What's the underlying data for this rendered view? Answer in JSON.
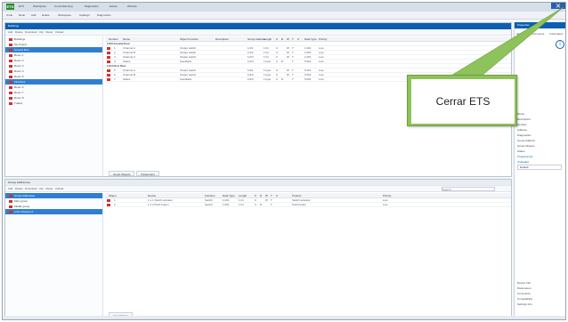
{
  "app": {
    "logo_text": "ETS",
    "menu": [
      "ETS",
      "Workspace",
      "Commissioning",
      "Diagnostics",
      "Extras",
      "Window"
    ],
    "close_icon": "close-icon"
  },
  "toolbar": {
    "items": [
      "Undo",
      "Redo",
      "Add",
      "Delete",
      "Workspace",
      "Catalogs",
      "Diagnostics"
    ]
  },
  "top_panel": {
    "title": "Buildings",
    "toolbar_items": [
      "Add",
      "Delete",
      "Download",
      "Info",
      "Reset",
      "Unload"
    ],
    "search_placeholder": "Search",
    "tree": [
      {
        "label": "Buildings",
        "selected": false
      },
      {
        "label": "My Project",
        "selected": false
      },
      {
        "label": "Ground floor",
        "selected": true
      },
      {
        "label": "Room 1",
        "selected": false
      },
      {
        "label": "Room 2",
        "selected": false
      },
      {
        "label": "Room 3",
        "selected": false
      },
      {
        "label": "Room 4",
        "selected": false
      },
      {
        "label": "Room 5",
        "selected": false
      },
      {
        "label": "First floor",
        "selected": true
      },
      {
        "label": "Room 6",
        "selected": false
      },
      {
        "label": "Room 7",
        "selected": false
      },
      {
        "label": "Room 8",
        "selected": false
      },
      {
        "label": "Trades",
        "selected": false
      }
    ],
    "columns": [
      "Number",
      "Name",
      "Object Function",
      "Description",
      "Group Address",
      "Length",
      "C",
      "R",
      "W",
      "T",
      "U",
      "Data Type",
      "Priority"
    ],
    "group_rows": [
      {
        "header": "1/1/3 Ground floor"
      },
      {
        "cells": [
          "1",
          "Channel A",
          "Output switch",
          "",
          "1/1/1",
          "1 bit",
          "C",
          "",
          "W",
          "T",
          "",
          "1.001",
          "Low"
        ]
      },
      {
        "cells": [
          "2",
          "Channel B",
          "Output switch",
          "",
          "1/1/2",
          "1 bit",
          "C",
          "",
          "W",
          "T",
          "",
          "1.001",
          "Low"
        ]
      },
      {
        "cells": [
          "3",
          "Channel C",
          "Output switch",
          "",
          "1/1/3",
          "1 bit",
          "C",
          "",
          "W",
          "T",
          "",
          "1.001",
          "Low"
        ]
      },
      {
        "cells": [
          "4",
          "Status",
          "Feedback",
          "",
          "1/1/4",
          "1 byte",
          "C",
          "R",
          "",
          "T",
          "",
          "5.001",
          "Low"
        ]
      },
      {
        "header": "1/1/4 First floor"
      },
      {
        "cells": [
          "5",
          "Channel A",
          "Output switch",
          "",
          "1/2/1",
          "1 byte",
          "C",
          "",
          "W",
          "T",
          "",
          "5.001",
          "Low"
        ]
      },
      {
        "cells": [
          "6",
          "Channel B",
          "Output switch",
          "",
          "1/2/2",
          "1 byte",
          "C",
          "",
          "W",
          "T",
          "",
          "5.001",
          "Low"
        ]
      },
      {
        "cells": [
          "7",
          "Status",
          "Feedback",
          "",
          "1/2/3",
          "1 byte",
          "C",
          "R",
          "",
          "T",
          "",
          "5.001",
          "Low"
        ]
      }
    ],
    "tabs": [
      "Group Objects",
      "Parameters"
    ]
  },
  "properties": {
    "title": "Properties",
    "tabs": [
      "Settings",
      "Comments",
      "Information"
    ],
    "fields": [
      "Name",
      "Description",
      "Number",
      "Address",
      "Diagnostics",
      "Group Address",
      "Group Objects",
      "Status"
    ],
    "value_fields": [
      "Programmed",
      "Unloaded"
    ],
    "bottom_links": [
      "Device Info",
      "Parameters",
      "Comments",
      "Compatibility",
      "Settings Info"
    ],
    "select_value": "Default"
  },
  "bottom_panel": {
    "title": "Group Addresses",
    "toolbar_items": [
      "Add",
      "Delete",
      "Download",
      "Info",
      "Reset",
      "Unload"
    ],
    "search_placeholder": "Search",
    "tree": [
      {
        "label": "Group Addresses",
        "selected": true
      },
      {
        "label": "Main group",
        "selected": false
      },
      {
        "label": "Middle group",
        "selected": false
      },
      {
        "label": "1/1/1 Channel A",
        "selected": true
      }
    ],
    "columns": [
      "Object",
      "Device",
      "Function",
      "Data Type",
      "Length",
      "C",
      "R",
      "W",
      "T",
      "U",
      "Product",
      "Priority"
    ],
    "rows": [
      {
        "cells": [
          "1",
          "1.1.1 Switch actuator",
          "Switch",
          "1.001",
          "1 bit",
          "C",
          "",
          "W",
          "T",
          "",
          "Switch actuator",
          "Low"
        ]
      },
      {
        "cells": [
          "2",
          "1.1.2 Push button",
          "Switch",
          "1.001",
          "1 bit",
          "C",
          "R",
          "",
          "T",
          "",
          "Push button",
          "Low"
        ]
      }
    ],
    "tab": "Associations"
  },
  "callout": {
    "text": "Cerrar ETS"
  },
  "colors": {
    "accent": "#0b5fb0",
    "selection": "#2f7fd0",
    "callout_green": "#8ec25a",
    "close_button": "#2a5faa"
  }
}
